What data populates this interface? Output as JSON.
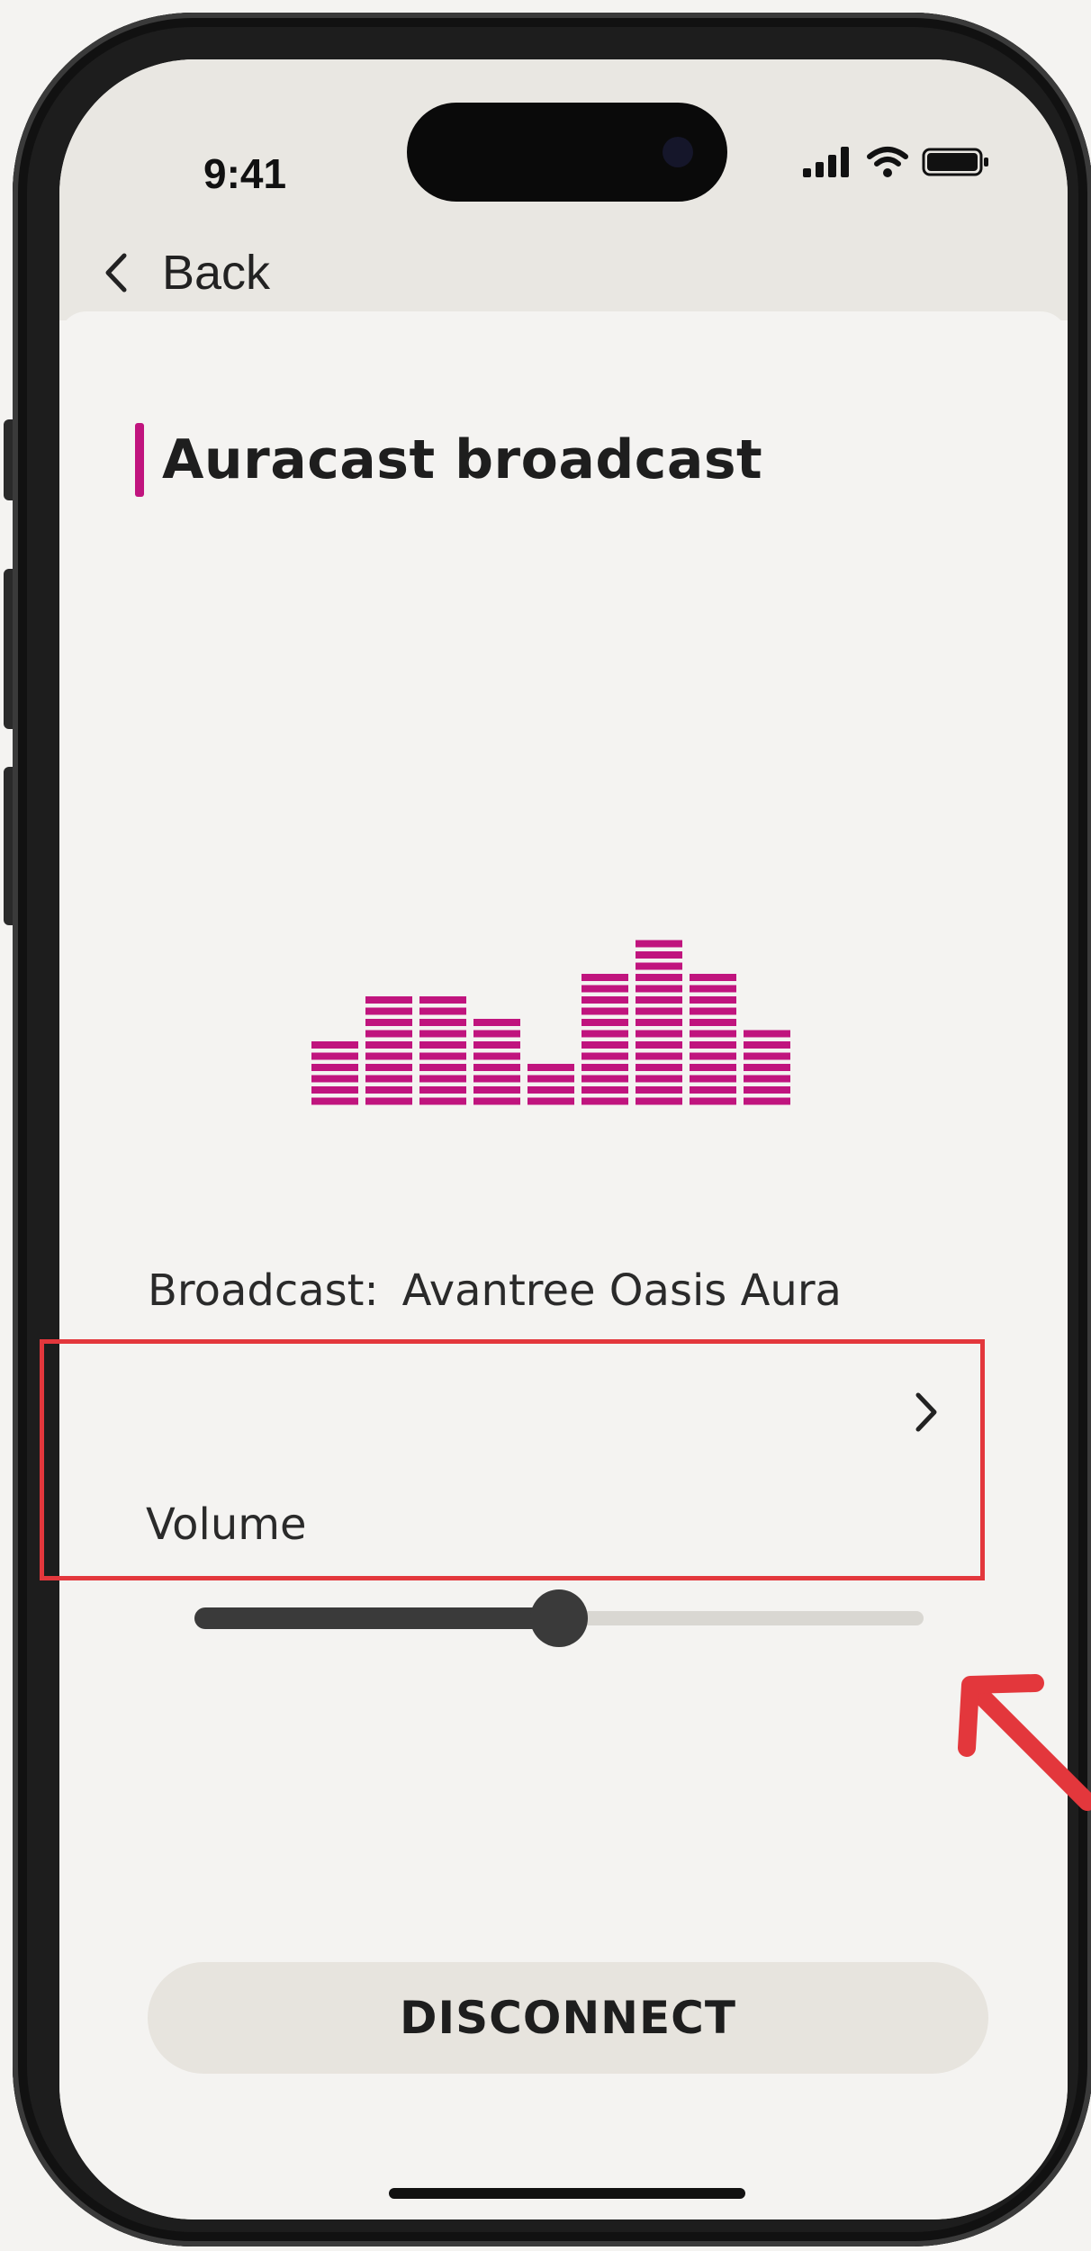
{
  "status_bar": {
    "time": "9:41",
    "signal_icon": "signal-bars-icon",
    "wifi_icon": "wifi-icon",
    "battery_icon": "battery-icon"
  },
  "nav": {
    "back_label": "Back",
    "back_icon": "chevron-left-icon"
  },
  "page": {
    "title": "Auracast broadcast",
    "accent_color": "#c0147e"
  },
  "equalizer": {
    "icon": "equalizer-icon",
    "color": "#c0147e",
    "column_levels": [
      6,
      10,
      10,
      8,
      4,
      12,
      15,
      12,
      7
    ]
  },
  "broadcast": {
    "label": "Broadcast:",
    "value": "Avantree Oasis Aura",
    "chevron_icon": "chevron-right-icon"
  },
  "volume": {
    "label": "Volume",
    "level": 0.5,
    "highlight_color": "#e3373c"
  },
  "actions": {
    "disconnect_label": "DISCONNECT"
  },
  "annotation": {
    "arrow_icon": "red-arrow-icon",
    "color": "#e3373c"
  }
}
